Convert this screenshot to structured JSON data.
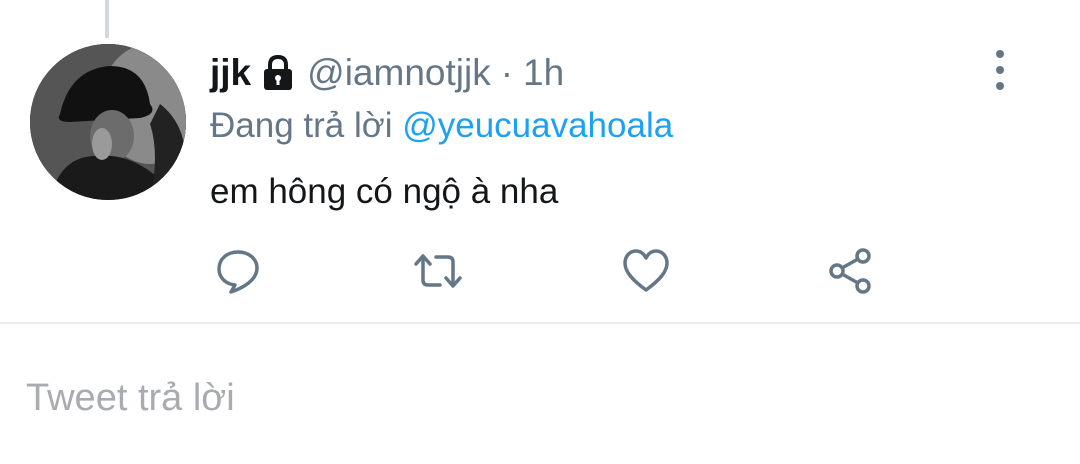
{
  "tweet": {
    "display_name": "jjk",
    "handle": "@iamnotjjk",
    "separator": "·",
    "time": "1h",
    "replying_to_prefix": "Đang trả lời",
    "replying_to_handle": "@yeucuavahoala",
    "text": "em hông có ngộ à nha",
    "protected_icon": "lock-icon",
    "menu_icon": "vertical-ellipsis-icon"
  },
  "actions": [
    {
      "name": "reply",
      "icon": "speech-bubble-icon"
    },
    {
      "name": "retweet",
      "icon": "retweet-icon"
    },
    {
      "name": "like",
      "icon": "heart-icon"
    },
    {
      "name": "share",
      "icon": "share-icon"
    }
  ],
  "compose": {
    "placeholder": "Tweet trả lời"
  },
  "colors": {
    "text_primary": "#14171a",
    "text_secondary": "#657786",
    "accent": "#1da1f2",
    "divider": "#e6ecf0"
  }
}
